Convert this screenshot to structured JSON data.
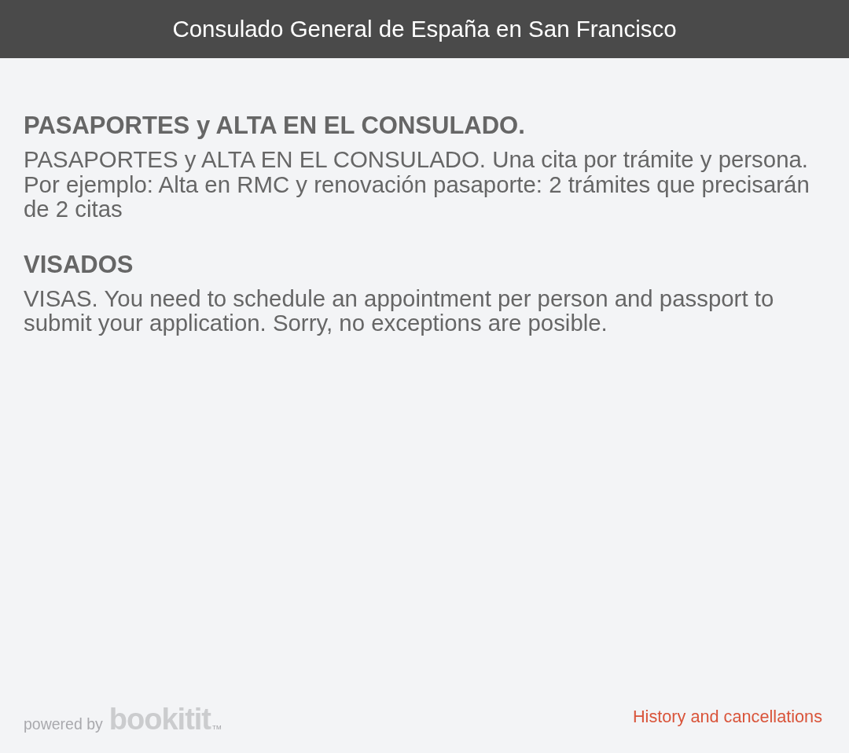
{
  "header": {
    "title": "Consulado General de España en San Francisco"
  },
  "sections": [
    {
      "heading": "PASAPORTES y ALTA EN EL CONSULADO.",
      "text": "PASAPORTES y ALTA EN EL CONSULADO. Una cita por trámite y persona. Por ejemplo: Alta en RMC y renovación pasaporte: 2 trámites que precisarán de 2 citas"
    },
    {
      "heading": "VISADOS",
      "text": "VISAS. You need to schedule an appointment per person and passport to submit your application. Sorry, no exceptions are posible."
    }
  ],
  "footer": {
    "powered_by": "powered by",
    "logo": "bookitit",
    "logo_mark": "TM",
    "link": "History and cancellations"
  }
}
